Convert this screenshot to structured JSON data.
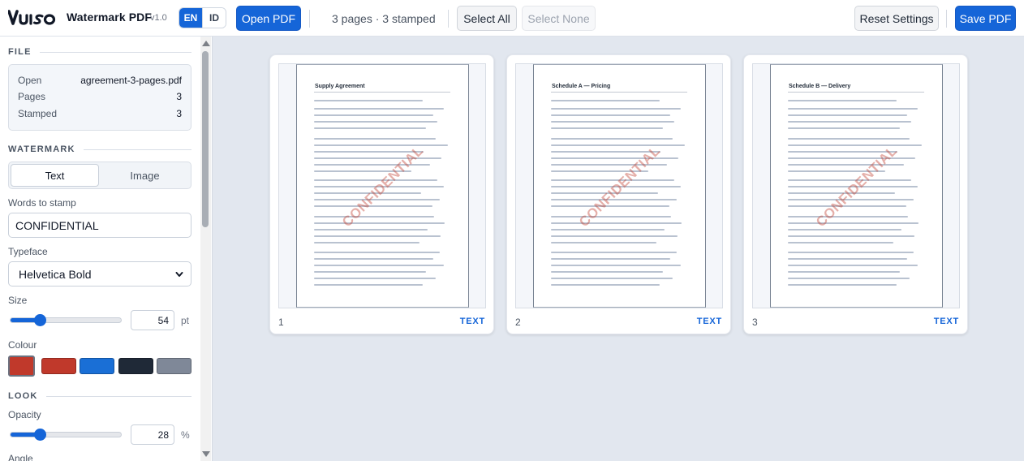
{
  "header": {
    "logo_text": "VUISO",
    "app_name": "Watermark PDF",
    "version": "v1.0",
    "languages": [
      "EN",
      "ID"
    ],
    "active_language": "EN",
    "open_label": "Open PDF",
    "status": "3 pages · 3 stamped",
    "select_all_label": "Select All",
    "select_none_label": "Select None",
    "reset_label": "Reset Settings",
    "save_label": "Save PDF"
  },
  "sidebar": {
    "file": {
      "heading": "FILE",
      "rows": [
        {
          "label": "Open",
          "value": "agreement-3-pages.pdf"
        },
        {
          "label": "Pages",
          "value": "3"
        },
        {
          "label": "Stamped",
          "value": "3"
        }
      ]
    },
    "watermark": {
      "heading": "WATERMARK",
      "modes": [
        "Text",
        "Image"
      ],
      "active_mode": "Text",
      "words_label": "Words to stamp",
      "words_value": "CONFIDENTIAL",
      "typeface_label": "Typeface",
      "typeface_value": "Helvetica Bold",
      "size_label": "Size",
      "size_value": "54",
      "size_unit": "pt",
      "size_slider_fraction": 0.27,
      "colour_label": "Colour",
      "colours": [
        "#c0392b",
        "#c0392b",
        "#1a6fd6",
        "#1f2937",
        "#7f8898"
      ],
      "selected_colour_index": 0
    },
    "look": {
      "heading": "LOOK",
      "opacity_label": "Opacity",
      "opacity_value": "28",
      "opacity_unit": "%",
      "opacity_slider_fraction": 0.27,
      "angle_label": "Angle"
    }
  },
  "pages": [
    {
      "number": "1",
      "doc_title": "Supply Agreement",
      "watermark": "CONFIDENTIAL",
      "mode": "TEXT"
    },
    {
      "number": "2",
      "doc_title": "Schedule A — Pricing",
      "watermark": "CONFIDENTIAL",
      "mode": "TEXT"
    },
    {
      "number": "3",
      "doc_title": "Schedule B — Delivery",
      "watermark": "CONFIDENTIAL",
      "mode": "TEXT"
    }
  ],
  "theme": {
    "accent": "#1565d8",
    "watermark_color": "#c0392b",
    "watermark_opacity": 0.28
  }
}
